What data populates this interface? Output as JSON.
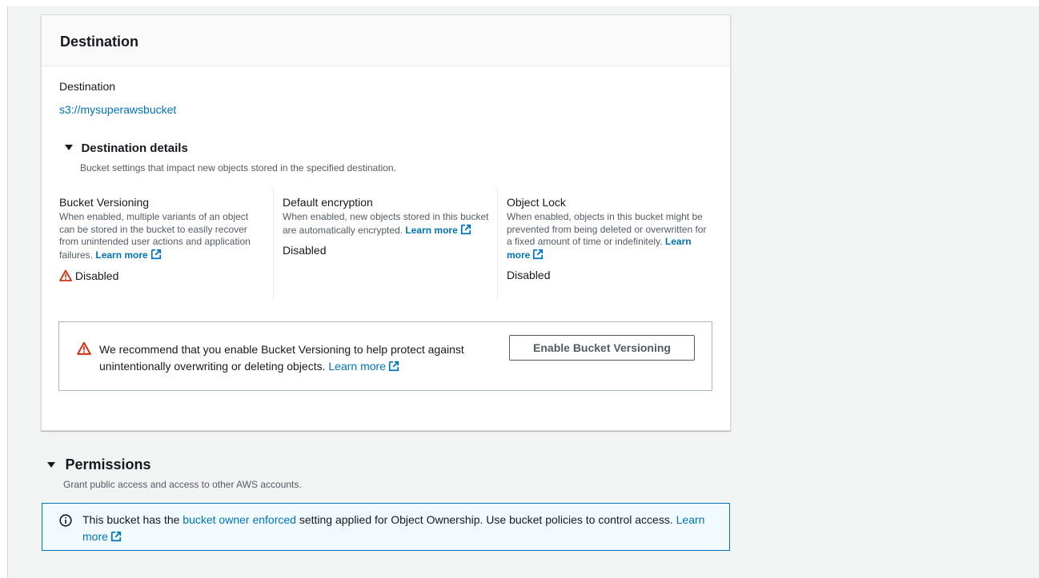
{
  "destination_card": {
    "title": "Destination",
    "field_label": "Destination",
    "field_value": "s3://mysuperawsbucket",
    "details": {
      "title": "Destination details",
      "description": "Bucket settings that impact new objects stored in the specified destination."
    },
    "columns": [
      {
        "title": "Bucket Versioning",
        "description": "When enabled, multiple variants of an object can be stored in the bucket to easily recover from unintended user actions and application failures.",
        "learn_more": "Learn more",
        "value": "Disabled"
      },
      {
        "title": "Default encryption",
        "description": "When enabled, new objects stored in this bucket are automatically encrypted.",
        "learn_more": "Learn more",
        "value": "Disabled"
      },
      {
        "title": "Object Lock",
        "description": "When enabled, objects in this bucket might be prevented from being deleted or overwritten for a fixed amount of time or indefinitely.",
        "learn_more": "Learn more",
        "value": "Disabled"
      }
    ],
    "alert": {
      "text": "We recommend that you enable Bucket Versioning to help protect against unintentionally overwriting or deleting objects.",
      "learn_more": "Learn more",
      "button": "Enable Bucket Versioning"
    }
  },
  "permissions": {
    "title": "Permissions",
    "description": "Grant public access and access to other AWS accounts.",
    "info": {
      "text_before": "This bucket has the",
      "link": "bucket owner enforced",
      "text_after": "setting applied for Object Ownership. Use bucket policies to control access.",
      "learn_more": "Learn more"
    }
  },
  "colors": {
    "link": "#0073bb",
    "warning": "#d13212",
    "info_bg": "#f1faff",
    "page_bg": "#f2f3f3"
  },
  "icons": [
    "external-link-icon",
    "warning-icon",
    "info-icon",
    "caret-down-icon"
  ]
}
